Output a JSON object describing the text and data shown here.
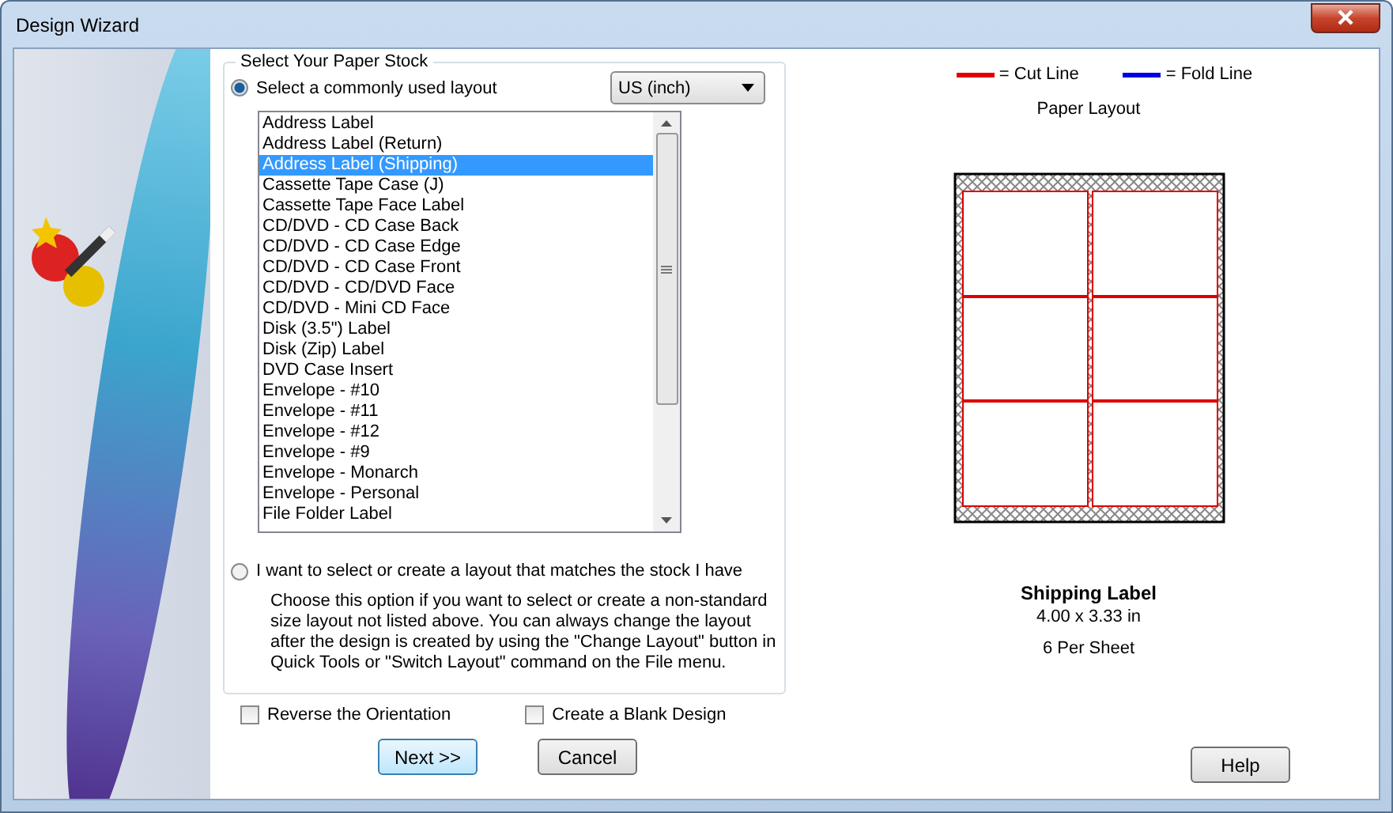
{
  "window": {
    "title": "Design Wizard"
  },
  "paper_stock": {
    "title": "Select Your Paper Stock",
    "options": [
      {
        "label": "Select a commonly used layout",
        "selected": true
      },
      {
        "label": "I want to select or create a layout that matches the stock I have",
        "selected": false
      }
    ],
    "units_dropdown": {
      "value": "US (inch)"
    },
    "layouts": [
      {
        "label": "Address Label",
        "selected": false
      },
      {
        "label": "Address Label (Return)",
        "selected": false
      },
      {
        "label": "Address Label (Shipping)",
        "selected": true
      },
      {
        "label": "Cassette Tape Case (J)",
        "selected": false
      },
      {
        "label": "Cassette Tape Face Label",
        "selected": false
      },
      {
        "label": "CD/DVD - CD Case Back",
        "selected": false
      },
      {
        "label": "CD/DVD - CD Case Edge",
        "selected": false
      },
      {
        "label": "CD/DVD - CD Case Front",
        "selected": false
      },
      {
        "label": "CD/DVD - CD/DVD Face",
        "selected": false
      },
      {
        "label": "CD/DVD - Mini CD Face",
        "selected": false
      },
      {
        "label": "Disk (3.5\") Label",
        "selected": false
      },
      {
        "label": "Disk (Zip) Label",
        "selected": false
      },
      {
        "label": "DVD Case Insert",
        "selected": false
      },
      {
        "label": "Envelope - #10",
        "selected": false
      },
      {
        "label": "Envelope - #11",
        "selected": false
      },
      {
        "label": "Envelope - #12",
        "selected": false
      },
      {
        "label": "Envelope - #9",
        "selected": false
      },
      {
        "label": "Envelope - Monarch",
        "selected": false
      },
      {
        "label": "Envelope - Personal",
        "selected": false
      },
      {
        "label": "File Folder Label",
        "selected": false
      }
    ],
    "description": "Choose this option if you want to select or create a non-standard size layout not listed above. You can always change the layout after the design is created by using the \"Change Layout\" button in Quick Tools or \"Switch Layout\" command on the File menu."
  },
  "checkboxes": [
    {
      "label": "Reverse the Orientation",
      "checked": false
    },
    {
      "label": "Create a Blank Design",
      "checked": false
    }
  ],
  "buttons": {
    "next": "Next >>",
    "cancel": "Cancel",
    "help": "Help"
  },
  "legend": [
    {
      "label": "= Cut Line",
      "color": "#e00000"
    },
    {
      "label": "= Fold Line",
      "color": "#0000e0"
    }
  ],
  "preview": {
    "title": "Paper Layout",
    "label_name": "Shipping Label",
    "label_size": "4.00 x 3.33 in",
    "per_sheet": "6 Per Sheet"
  }
}
